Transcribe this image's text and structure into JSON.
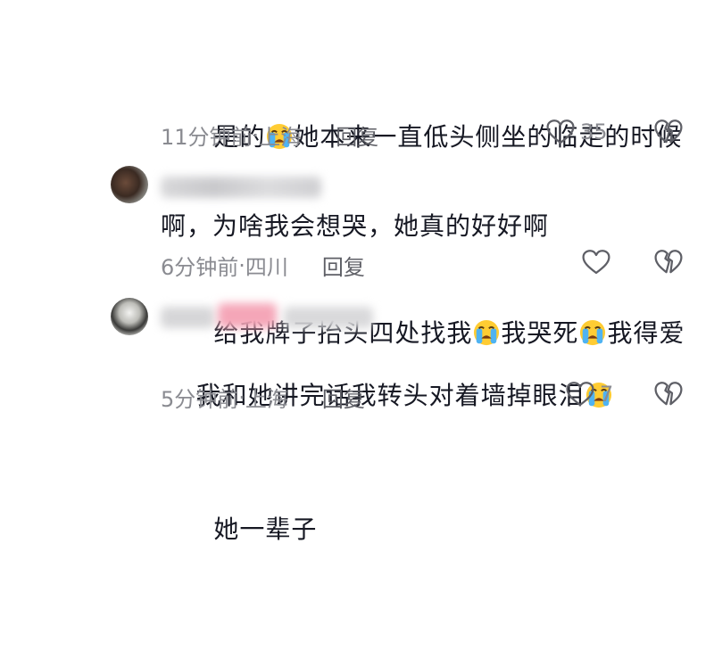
{
  "comments": [
    {
      "lines": [
        [
          "是的",
          "emoji",
          "她本来一直低头侧坐的临走的时候"
        ],
        [
          "给我牌子抬头四处找我",
          "emoji",
          "我哭死",
          "emoji",
          "我得爱"
        ],
        [
          "她一辈子"
        ]
      ],
      "time": "11分钟前",
      "separator": " · ",
      "location": "上海",
      "reply_label": "回复",
      "likes": "35"
    },
    {
      "text": "啊，为啥我会想哭，她真的好好啊",
      "time": "6分钟前",
      "separator": " · ",
      "location": "四川",
      "reply_label": "回复",
      "likes": ""
    },
    {
      "text": "我和她讲完话我转头对着墙掉眼泪",
      "time": "5分钟前",
      "separator": " · ",
      "location": "上海",
      "reply_label": "回复",
      "likes": "7"
    }
  ],
  "colors": {
    "text": "#161823",
    "meta": "#8a8b91",
    "reply": "#5e5f66",
    "icon": "#5e5f66"
  },
  "icons": {
    "emoji": "loudly-crying-face-icon",
    "like": "heart-outline-icon",
    "dislike": "broken-heart-icon"
  }
}
